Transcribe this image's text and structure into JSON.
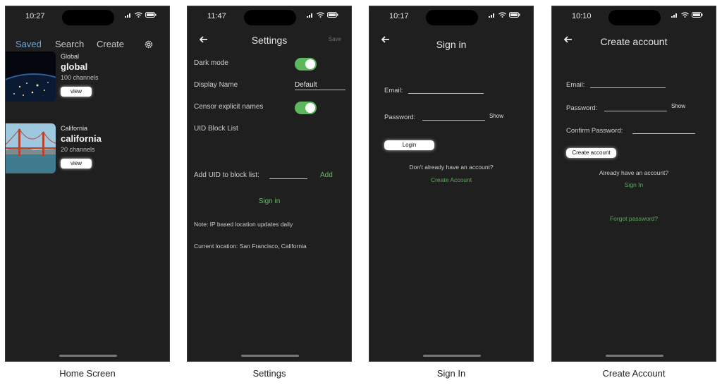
{
  "screens": [
    {
      "caption": "Home Screen",
      "time": "10:27",
      "nav": {
        "saved": "Saved",
        "search": "Search",
        "create": "Create"
      },
      "cards": [
        {
          "sub": "Global",
          "title": "global",
          "count": "100 channels",
          "button": "view"
        },
        {
          "sub": "California",
          "title": "california",
          "count": "20 channels",
          "button": "view"
        }
      ]
    },
    {
      "caption": "Settings",
      "time": "11:47",
      "title": "Settings",
      "save": "Save",
      "dark_mode": "Dark mode",
      "display_name_label": "Display Name",
      "display_name_value": "Default",
      "censor": "Censor explicit names",
      "uid_block_list": "UID Block List",
      "add_uid_label": "Add UID to block list:",
      "add": "Add",
      "sign_in": "Sign in",
      "note": "Note: IP based location updates daily",
      "current_location": "Current location: San Francisco, California",
      "dark_mode_on": true,
      "censor_on": true
    },
    {
      "caption": "Sign In",
      "time": "10:17",
      "title": "Sign in",
      "email": "Email:",
      "password": "Password:",
      "show": "Show",
      "login": "Login",
      "no_account": "Don't already have an account?",
      "create_account": "Create Account"
    },
    {
      "caption": "Create Account",
      "time": "10:10",
      "title": "Create account",
      "email": "Email:",
      "password": "Password:",
      "show": "Show",
      "confirm_password": "Confirm Password:",
      "create_button": "Create account",
      "have_account": "Already have an account?",
      "sign_in": "Sign In",
      "forgot": "Forgot password?"
    }
  ],
  "colors": {
    "background": "#1f1f1f",
    "accent_blue": "#6fa6d6",
    "accent_green": "#5cb85c"
  }
}
